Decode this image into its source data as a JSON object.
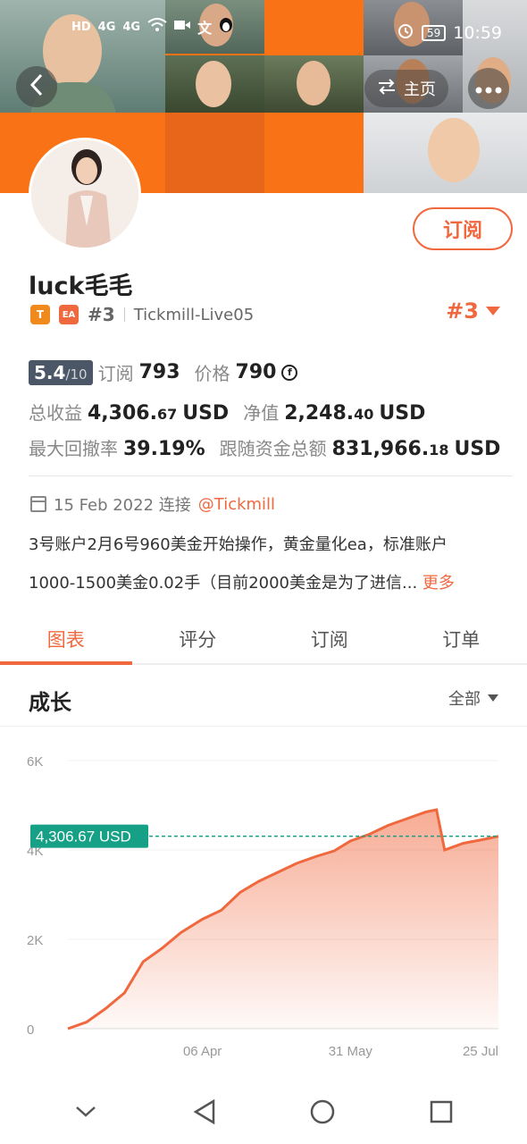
{
  "status_bar": {
    "left_icons": [
      "HD",
      "4G",
      "4G",
      "wifi-icon",
      "video-icon",
      "translate-icon",
      "penguin-icon"
    ],
    "battery": "59",
    "time": "10:59"
  },
  "header": {
    "home_label": "主页"
  },
  "profile": {
    "subscribe_label": "订阅",
    "username": "luck毛毛",
    "badge_t": "T",
    "badge_ea": "EA",
    "rank_small": "#3",
    "server": "Tickmill-Live05",
    "rank_big": "#3"
  },
  "stats": {
    "score": "5.4",
    "score_max": "/10",
    "subs_label": "订阅",
    "subs_value": "793",
    "price_label": "价格",
    "price_value": "790",
    "price_icon": "coin-icon",
    "total_profit_label": "总收益",
    "total_profit_int": "4,306.",
    "total_profit_dec": "67",
    "total_profit_unit": "USD",
    "equity_label": "净值",
    "equity_int": "2,248.",
    "equity_dec": "40",
    "equity_unit": "USD",
    "drawdown_label": "最大回撤率",
    "drawdown_value": "39.19%",
    "follow_label": "跟随资金总额",
    "follow_int": "831,966.",
    "follow_dec": "18",
    "follow_unit": "USD"
  },
  "since": {
    "date": "15 Feb 2022 连接",
    "broker_link": "@Tickmill"
  },
  "description": {
    "line1": "3号账户2月6号960美金开始操作，黄金量化ea，标准账户",
    "line2": "1000-1500美金0.02手（目前2000美金是为了进信...",
    "more": "更多"
  },
  "tabs": [
    {
      "label": "图表",
      "active": true
    },
    {
      "label": "评分",
      "active": false
    },
    {
      "label": "订阅",
      "active": false
    },
    {
      "label": "订单",
      "active": false
    }
  ],
  "growth": {
    "title": "成长",
    "filter": "全部"
  },
  "chart_data": {
    "type": "area",
    "y_ticks": [
      "6K",
      "4K",
      "2K",
      "0"
    ],
    "x_ticks": [
      "06 Apr",
      "31 May",
      "25 Jul"
    ],
    "ylim": [
      0,
      6000
    ],
    "current_label": "4,306.67 USD",
    "current_value": 4306.67,
    "accent_color": "#f0683e",
    "label_color": "#16a085",
    "x": [
      "2022-02-15",
      "2022-02-22",
      "2022-03-01",
      "2022-03-08",
      "2022-03-15",
      "2022-03-22",
      "2022-03-29",
      "2022-04-06",
      "2022-04-13",
      "2022-04-20",
      "2022-04-27",
      "2022-05-04",
      "2022-05-11",
      "2022-05-18",
      "2022-05-25",
      "2022-05-31",
      "2022-06-07",
      "2022-06-14",
      "2022-06-21",
      "2022-06-28",
      "2022-07-02",
      "2022-07-05",
      "2022-07-12",
      "2022-07-19",
      "2022-07-25"
    ],
    "values": [
      0,
      150,
      450,
      800,
      1500,
      1800,
      2150,
      2450,
      2650,
      3050,
      3300,
      3500,
      3700,
      3850,
      3980,
      4200,
      4350,
      4550,
      4700,
      4850,
      4900,
      4000,
      4150,
      4230,
      4306.67
    ]
  },
  "nav": {
    "icons": [
      "chevron-down-icon",
      "back-triangle-icon",
      "home-circle-icon",
      "recents-square-icon"
    ]
  }
}
